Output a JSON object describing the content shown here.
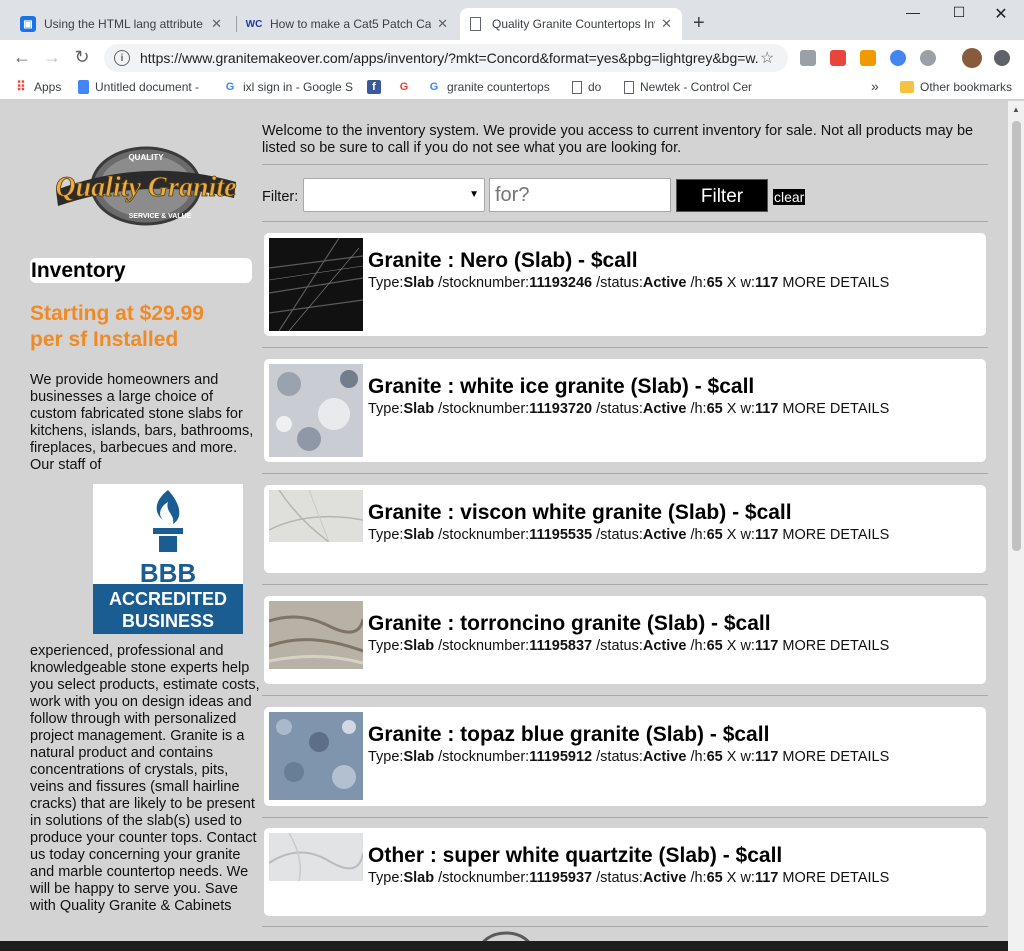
{
  "browser": {
    "tabs": [
      {
        "title": "Using the HTML lang attribute | T",
        "icon": "globe-blue-icon"
      },
      {
        "title": "How to make a Cat5 Patch Cable",
        "icon": "wc-favicon"
      },
      {
        "title": "Quality Granite Countertops Inve",
        "icon": "page-icon"
      }
    ],
    "new_tab": "+",
    "url": "https://www.granitemakeover.com/apps/inventory/?mkt=Concord&format=yes&pbg=lightgrey&bg=w...",
    "bookmarks": [
      {
        "label": "Apps",
        "icon": "apps-grid-icon"
      },
      {
        "label": "Untitled document -",
        "icon": "docs-icon"
      },
      {
        "label": "ixl sign in - Google S",
        "icon": "google-icon"
      },
      {
        "label": "",
        "icon": "facebook-icon"
      },
      {
        "label": "",
        "icon": "google-icon"
      },
      {
        "label": "granite countertops",
        "icon": "google-icon"
      },
      {
        "label": "do",
        "icon": "page-icon"
      },
      {
        "label": "Newtek - Control Cer",
        "icon": "page-icon"
      }
    ],
    "overflow": "»",
    "other_bookmarks": "Other bookmarks"
  },
  "sidebar": {
    "inventory_title": "Inventory",
    "promo": "Starting at $29.99 per sf Installed",
    "desc_part1": "We provide homeowners and businesses a large choice of custom fabricated stone slabs for kitchens, islands, bars, bathrooms, fireplaces, barbecues and more. Our staff of",
    "bbb_top": "BBB",
    "bbb_line1": "ACCREDITED",
    "bbb_line2": "BUSINESS",
    "desc_part2": "experienced, professional and knowledgeable stone experts help you select products, estimate costs, work with you on design ideas and follow through with personalized project management. Granite is a natural product and contains concentrations of crystals, pits, veins and fissures (small hairline cracks) that are likely to be present in solutions of the slab(s) used to produce your counter tops. Contact us today concerning your granite and marble countertop needs. We will be happy to serve you. Save with Quality Granite & Cabinets"
  },
  "logo": {
    "main": "Quality Granite",
    "top": "QUALITY",
    "bottom": "SERVICE & VALUE"
  },
  "main": {
    "welcome": "Welcome to the inventory system. We provide you access to current inventory for sale. Not all products may be listed so be sure to call if you do not see what you are looking for.",
    "filter_label": "Filter:",
    "filter_select": "",
    "for_placeholder": "for?",
    "filter_button": "Filter",
    "clear_button": "clear",
    "labels": {
      "type": "Type:",
      "stock": " /stocknumber:",
      "status": " /status:",
      "h": " /h:",
      "x": " X w:",
      "more": " MORE DETAILS"
    },
    "items": [
      {
        "title": "Granite : Nero (Slab) - $call",
        "type": "Slab",
        "stock": "11193246",
        "status": "Active",
        "h": "65",
        "w": "117"
      },
      {
        "title": "Granite : white ice granite (Slab) - $call",
        "type": "Slab",
        "stock": "11193720",
        "status": "Active",
        "h": "65",
        "w": "117"
      },
      {
        "title": "Granite : viscon white granite (Slab) - $call",
        "type": "Slab",
        "stock": "11195535",
        "status": "Active",
        "h": "65",
        "w": "117"
      },
      {
        "title": "Granite : torroncino granite (Slab) - $call",
        "type": "Slab",
        "stock": "11195837",
        "status": "Active",
        "h": "65",
        "w": "117"
      },
      {
        "title": "Granite : topaz blue granite (Slab) - $call",
        "type": "Slab",
        "stock": "11195912",
        "status": "Active",
        "h": "65",
        "w": "117"
      },
      {
        "title": "Other : super white quartzite (Slab) - $call",
        "type": "Slab",
        "stock": "11195937",
        "status": "Active",
        "h": "65",
        "w": "117"
      }
    ]
  },
  "colors": {
    "accent": "#f08a24",
    "bbb_blue": "#1a5d93",
    "page_bg": "#d3d3d3"
  }
}
